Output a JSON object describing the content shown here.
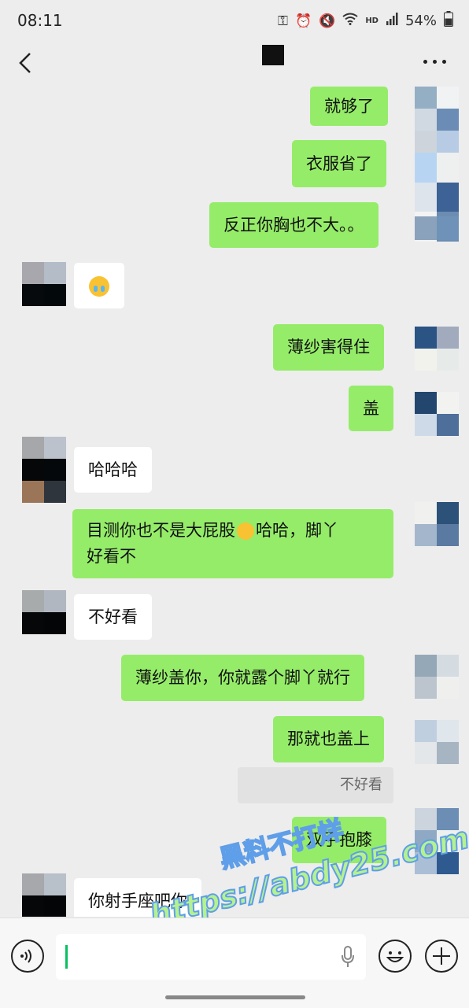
{
  "status": {
    "time": "08:11",
    "battery": "54%",
    "network": "HD"
  },
  "header": {
    "title": "",
    "more": "···"
  },
  "messages": [
    {
      "side": "sent",
      "text": "就够了"
    },
    {
      "side": "sent",
      "text": "衣服省了"
    },
    {
      "side": "sent",
      "text": "反正你胸也不大。。"
    },
    {
      "side": "recv",
      "text": "",
      "icon": "crying-emoji-icon"
    },
    {
      "side": "sent",
      "text": "薄纱害得住"
    },
    {
      "side": "sent",
      "text": "盖"
    },
    {
      "side": "recv",
      "text": "哈哈哈"
    },
    {
      "side": "sent",
      "text_a": "目测你也不是大屁股",
      "text_b": "哈哈，脚丫",
      "text_c": "好看不"
    },
    {
      "side": "recv",
      "text": "不好看"
    },
    {
      "side": "sent",
      "text": "薄纱盖你，你就露个脚丫就行"
    },
    {
      "side": "sent",
      "text": "那就也盖上"
    },
    {
      "side": "quote",
      "text": "不好看"
    },
    {
      "side": "sent",
      "text": "双手抱膝"
    },
    {
      "side": "recv",
      "text": "你射手座吧你"
    }
  ],
  "watermark": {
    "line1": "黑料不打烊",
    "line2": "https://abdy25.com"
  },
  "colors": {
    "sent_bubble": "#95ec69",
    "recv_bubble": "#ffffff",
    "background": "#ededed",
    "accent": "#07c160"
  }
}
